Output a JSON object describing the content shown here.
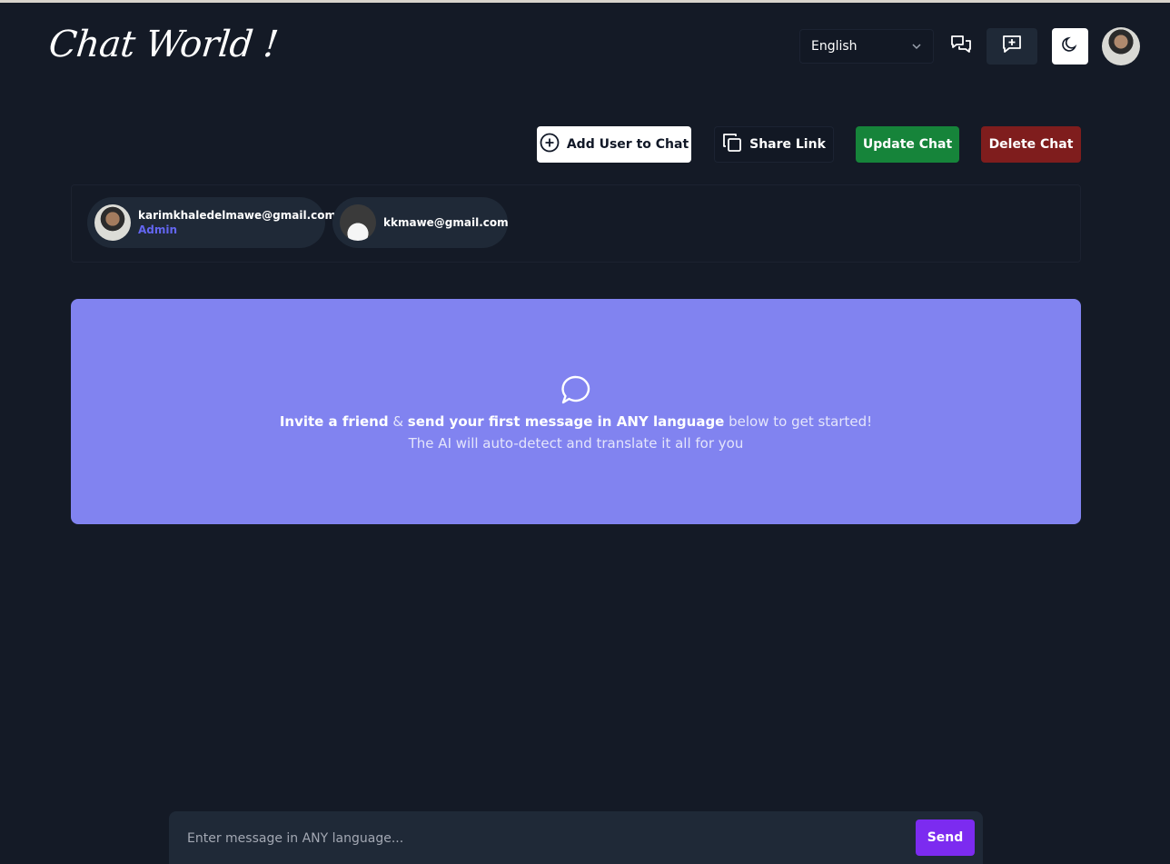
{
  "header": {
    "logo": "Chat World !",
    "language": {
      "selected": "English",
      "icon": "chevron-down-icon"
    },
    "icons": [
      "chats-icon",
      "new-chat-icon",
      "moon-icon",
      "user-avatar"
    ]
  },
  "actions": {
    "add_user": "Add User to Chat",
    "share_link": "Share Link",
    "update_chat": "Update Chat",
    "delete_chat": "Delete Chat"
  },
  "participants": [
    {
      "email": "karimkhaledelmawe@gmail.com",
      "role": "Admin"
    },
    {
      "email": "kkmawe@gmail.com",
      "role": ""
    }
  ],
  "empty_state": {
    "bold1": "Invite a friend",
    "amp": " & ",
    "bold2": "send your first message in ANY language",
    "tail": " below to get started!",
    "line2": "The AI will auto-detect and translate it all for you"
  },
  "composer": {
    "placeholder": "Enter message in ANY language...",
    "send": "Send"
  },
  "colors": {
    "background": "#141a26",
    "card": "#8183f0",
    "update": "#16843a",
    "delete": "#7f1d1d",
    "send": "#7c2bf0",
    "admin": "#6366f1"
  }
}
